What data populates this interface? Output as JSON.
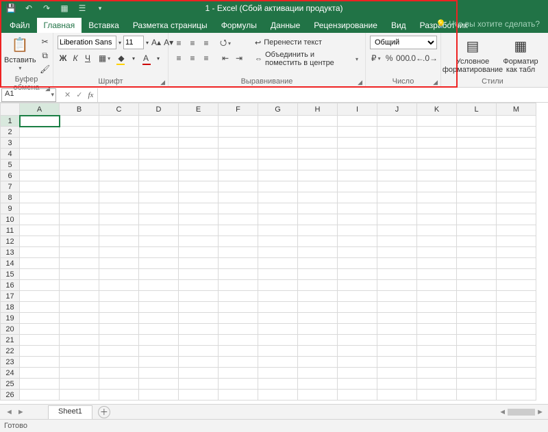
{
  "title": "1 - Excel (Сбой активации продукта)",
  "tabs": {
    "file": "Файл",
    "home": "Главная",
    "insert": "Вставка",
    "layout": "Разметка страницы",
    "formulas": "Формулы",
    "data": "Данные",
    "review": "Рецензирование",
    "view": "Вид",
    "developer": "Разработчик"
  },
  "tellme": "Что вы хотите сделать?",
  "ribbon": {
    "clipboard": {
      "paste": "Вставить",
      "label": "Буфер обмена"
    },
    "font": {
      "name": "Liberation Sans",
      "size": "11",
      "bold": "Ж",
      "italic": "К",
      "underline": "Ч",
      "label": "Шрифт"
    },
    "alignment": {
      "wrap": "Перенести текст",
      "merge": "Объединить и поместить в центре",
      "label": "Выравнивание"
    },
    "number": {
      "format": "Общий",
      "label": "Число"
    },
    "styles": {
      "cond": "Условное форматирование",
      "table": "Форматир как табл",
      "label": "Стили"
    }
  },
  "namebox": "A1",
  "columns": [
    "A",
    "B",
    "C",
    "D",
    "E",
    "F",
    "G",
    "H",
    "I",
    "J",
    "K",
    "L",
    "M"
  ],
  "rows": [
    "1",
    "2",
    "3",
    "4",
    "5",
    "6",
    "7",
    "8",
    "9",
    "10",
    "11",
    "12",
    "13",
    "14",
    "15",
    "16",
    "17",
    "18",
    "19",
    "20",
    "21",
    "22",
    "23",
    "24",
    "25",
    "26"
  ],
  "sheet_tab": "Sheet1",
  "status": "Готово"
}
